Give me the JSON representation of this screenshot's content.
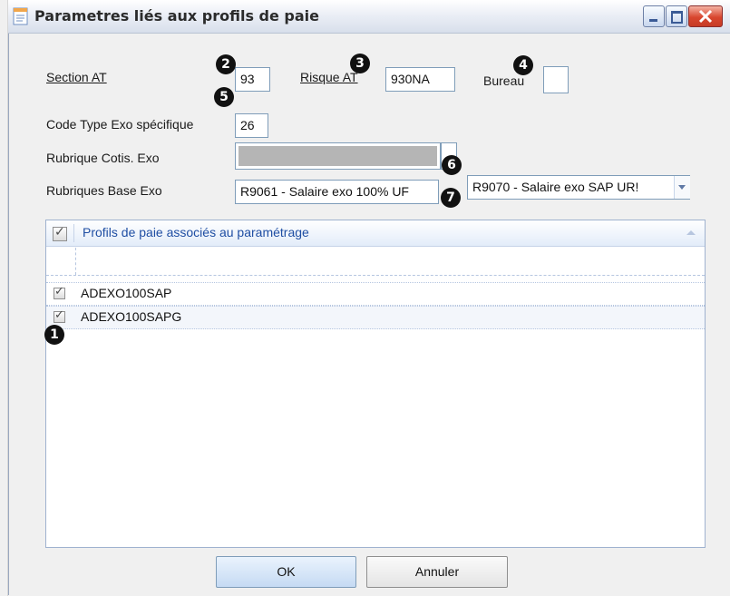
{
  "window": {
    "title": "Parametres liés aux profils de paie"
  },
  "form": {
    "section_at": {
      "label": "Section AT",
      "value": "93"
    },
    "risque_at": {
      "label": "Risque AT",
      "value": "930NA"
    },
    "bureau": {
      "label": "Bureau",
      "value": ""
    },
    "code_type_exo": {
      "label": "Code Type Exo spécifique",
      "value": "26"
    },
    "rubrique_cotis": {
      "label": "Rubrique Cotis. Exo",
      "value": ""
    },
    "rubriques_base": {
      "label": "Rubriques Base Exo",
      "value1": "R9061 - Salaire exo 100% UF",
      "value2": "R9070 - Salaire exo SAP UR!"
    }
  },
  "badges": [
    "1",
    "2",
    "3",
    "4",
    "5",
    "6",
    "7"
  ],
  "grid": {
    "header": "Profils de paie associés au paramétrage",
    "header_checked": true,
    "rows": [
      {
        "label": "ADEXO100SAP",
        "checked": true
      },
      {
        "label": "ADEXO100SAPG",
        "checked": true
      }
    ]
  },
  "buttons": {
    "ok": "OK",
    "cancel": "Annuler"
  },
  "colors": {
    "title_bar": "#e9edf5",
    "grid_header_text": "#1f4ea3",
    "button_bg": "#c5daf3"
  },
  "icons": [
    "form-icon",
    "minimize-icon",
    "maximize-icon",
    "close-icon",
    "ellipsis-icon",
    "dropdown-arrow-icon",
    "sort-arrow-icon"
  ]
}
